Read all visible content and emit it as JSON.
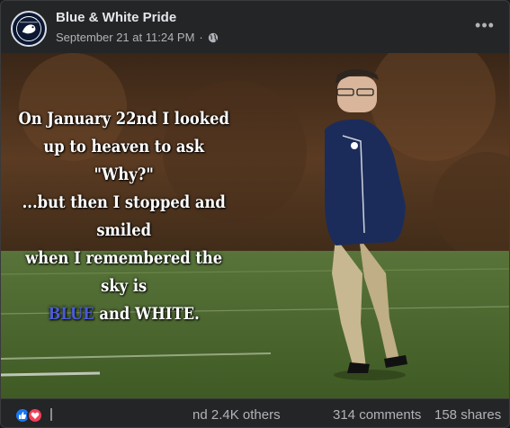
{
  "post": {
    "page_name": "Blue & White Pride",
    "timestamp": "September 21 at 11:24 PM",
    "separator": "·",
    "audience_icon": "globe-icon",
    "more_icon": "more-options-icon"
  },
  "image": {
    "quote_lines": [
      "On January 22nd I looked",
      "up to heaven to ask \"Why?\"",
      "...but then I stopped and smiled",
      "when I remembered the sky is"
    ],
    "quote_blue": "BLUE",
    "quote_and": "and",
    "quote_white": "WHITE",
    "quote_end": ".",
    "colors": {
      "blue_word": "#4b5bd6",
      "jacket": "#1c2c5a",
      "field": "#4e6a2e",
      "trees": "#5b3b22"
    }
  },
  "footer": {
    "reaction_icons": [
      "like-icon",
      "love-icon"
    ],
    "reaction_text": "nd 2.4K others",
    "comments": "314 comments",
    "shares": "158 shares"
  }
}
